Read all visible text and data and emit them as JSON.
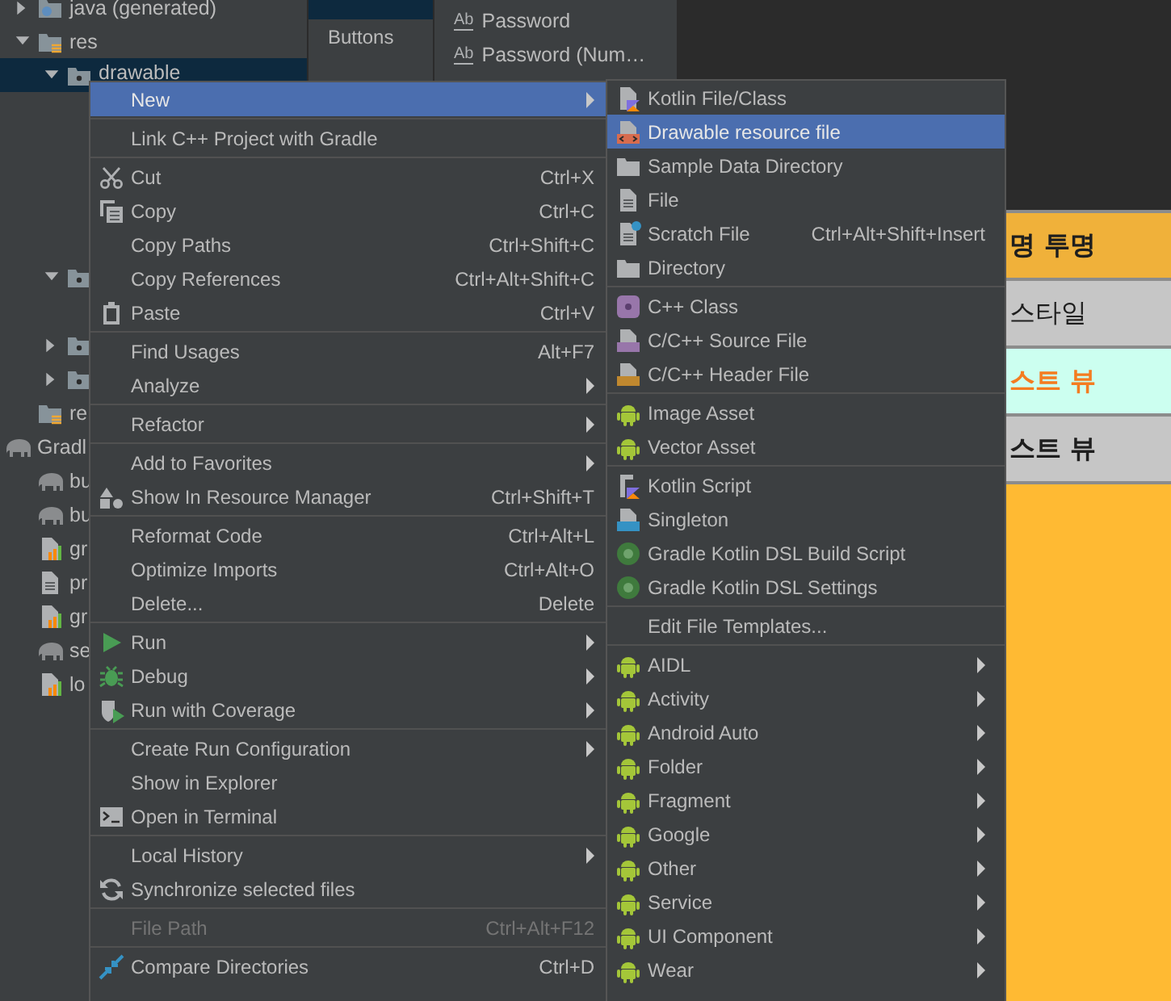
{
  "project_tree": [
    {
      "children": [
        {
          "label": "java (generated)",
          "kind": "java-folder",
          "expanded": false,
          "selected": false
        },
        {
          "label": "res",
          "kind": "res-folder",
          "expanded": true,
          "selected": false,
          "children": [
            {
              "label": "drawable",
              "kind": "folder",
              "expanded": true,
              "selected": true
            },
            {
              "kind": "folder",
              "expanded": true,
              "selected": false
            },
            {
              "kind": "folder",
              "expanded": false,
              "selected": false
            },
            {
              "kind": "folder",
              "expanded": false,
              "selected": false
            }
          ]
        },
        {
          "label": "re",
          "kind": "res-folder",
          "selected": false
        }
      ]
    },
    {
      "label": "Gradl",
      "kind": "gradle",
      "selected": false,
      "children": [
        {
          "label": "bu",
          "kind": "gradle",
          "selected": false
        },
        {
          "label": "bu",
          "kind": "gradle",
          "selected": false
        },
        {
          "label": "gr",
          "kind": "chart-file",
          "selected": false
        },
        {
          "label": "pr",
          "kind": "text-file",
          "selected": false
        },
        {
          "label": "gr",
          "kind": "chart-file",
          "selected": false
        },
        {
          "label": "se",
          "kind": "gradle",
          "selected": false
        },
        {
          "label": "lo",
          "kind": "chart-file",
          "selected": false
        }
      ]
    }
  ],
  "palette": {
    "categories": [
      {
        "selected": true
      },
      {
        "label": "Buttons",
        "selected": false
      }
    ],
    "items": [
      {
        "icon_text": "Ab",
        "label": "Password"
      },
      {
        "icon_text": "Ab",
        "label": "Password (Num…"
      }
    ]
  },
  "preview": {
    "buttons": [
      {
        "text": "명 투명",
        "color": "#f0b13a",
        "kind": "bold"
      },
      {
        "text": "스타일",
        "color": "#c6c6c6",
        "kind": "plain"
      },
      {
        "text": "스트 뷰",
        "color": "#ccfff0",
        "kind": "accent"
      },
      {
        "text": "스트 뷰",
        "color": "#c6c6c6",
        "kind": "bold"
      }
    ]
  },
  "context_menu": {
    "groups": [
      [
        {
          "label": "New",
          "submenu": true,
          "selected": true,
          "disabled": false
        }
      ],
      [
        {
          "label": "Link C++ Project with Gradle",
          "submenu": false,
          "selected": false,
          "disabled": false
        }
      ],
      [
        {
          "kind": "scissors",
          "label": "Cut",
          "shortcut": "Ctrl+X",
          "submenu": false,
          "selected": false,
          "disabled": false
        },
        {
          "kind": "copy",
          "label": "Copy",
          "shortcut": "Ctrl+C",
          "submenu": false,
          "selected": false,
          "disabled": false
        },
        {
          "label": "Copy Paths",
          "shortcut": "Ctrl+Shift+C",
          "submenu": false,
          "selected": false,
          "disabled": false
        },
        {
          "label": "Copy References",
          "shortcut": "Ctrl+Alt+Shift+C",
          "submenu": false,
          "selected": false,
          "disabled": false
        },
        {
          "kind": "paste",
          "label": "Paste",
          "shortcut": "Ctrl+V",
          "submenu": false,
          "selected": false,
          "disabled": false
        }
      ],
      [
        {
          "label": "Find Usages",
          "shortcut": "Alt+F7",
          "submenu": false,
          "selected": false,
          "disabled": false
        },
        {
          "label": "Analyze",
          "submenu": true,
          "selected": false,
          "disabled": false
        }
      ],
      [
        {
          "label": "Refactor",
          "submenu": true,
          "selected": false,
          "disabled": false
        }
      ],
      [
        {
          "label": "Add to Favorites",
          "submenu": true,
          "selected": false,
          "disabled": false
        },
        {
          "kind": "shapes",
          "label": "Show In Resource Manager",
          "shortcut": "Ctrl+Shift+T",
          "submenu": false,
          "selected": false,
          "disabled": false
        }
      ],
      [
        {
          "label": "Reformat Code",
          "shortcut": "Ctrl+Alt+L",
          "submenu": false,
          "selected": false,
          "disabled": false
        },
        {
          "label": "Optimize Imports",
          "shortcut": "Ctrl+Alt+O",
          "submenu": false,
          "selected": false,
          "disabled": false
        },
        {
          "label": "Delete...",
          "shortcut": "Delete",
          "submenu": false,
          "selected": false,
          "disabled": false
        }
      ],
      [
        {
          "kind": "run",
          "label": "Run",
          "submenu": true,
          "selected": false,
          "disabled": false
        },
        {
          "kind": "debug",
          "label": "Debug",
          "submenu": true,
          "selected": false,
          "disabled": false
        },
        {
          "kind": "coverage",
          "label": "Run with Coverage",
          "submenu": true,
          "selected": false,
          "disabled": false
        }
      ],
      [
        {
          "label": "Create Run Configuration",
          "submenu": true,
          "selected": false,
          "disabled": false
        },
        {
          "label": "Show in Explorer",
          "submenu": false,
          "selected": false,
          "disabled": false
        },
        {
          "kind": "terminal",
          "label": "Open in Terminal",
          "submenu": false,
          "selected": false,
          "disabled": false
        }
      ],
      [
        {
          "label": "Local History",
          "submenu": true,
          "selected": false,
          "disabled": false
        },
        {
          "kind": "sync",
          "label": "Synchronize selected files",
          "submenu": false,
          "selected": false,
          "disabled": false
        }
      ],
      [
        {
          "label": "File Path",
          "shortcut": "Ctrl+Alt+F12",
          "submenu": false,
          "selected": false,
          "disabled": true
        }
      ],
      [
        {
          "kind": "compare",
          "label": "Compare Directories",
          "shortcut": "Ctrl+D",
          "submenu": false,
          "selected": false,
          "disabled": false
        }
      ]
    ]
  },
  "new_submenu": {
    "groups": [
      [
        {
          "kind": "kotlin",
          "label": "Kotlin File/Class",
          "submenu": false,
          "selected": false,
          "disabled": false
        },
        {
          "kind": "drawable",
          "label": "Drawable resource file",
          "submenu": false,
          "selected": true,
          "disabled": false
        },
        {
          "kind": "folder",
          "label": "Sample Data Directory",
          "submenu": false,
          "selected": false,
          "disabled": false
        },
        {
          "kind": "file",
          "label": "File",
          "submenu": false,
          "selected": false,
          "disabled": false
        },
        {
          "kind": "scratch",
          "label": "Scratch File",
          "shortcut": "Ctrl+Alt+Shift+Insert",
          "submenu": false,
          "selected": false,
          "disabled": false
        },
        {
          "kind": "folder",
          "label": "Directory",
          "submenu": false,
          "selected": false,
          "disabled": false
        }
      ],
      [
        {
          "kind": "cpp-class",
          "label": "C++ Class",
          "submenu": false,
          "selected": false,
          "disabled": false
        },
        {
          "kind": "cpp-source",
          "label": "C/C++ Source File",
          "submenu": false,
          "selected": false,
          "disabled": false
        },
        {
          "kind": "cpp-header",
          "label": "C/C++ Header File",
          "submenu": false,
          "selected": false,
          "disabled": false
        }
      ],
      [
        {
          "kind": "android",
          "label": "Image Asset",
          "submenu": false,
          "selected": false,
          "disabled": false
        },
        {
          "kind": "android",
          "label": "Vector Asset",
          "submenu": false,
          "selected": false,
          "disabled": false
        }
      ],
      [
        {
          "kind": "kotlin-script",
          "label": "Kotlin Script",
          "submenu": false,
          "selected": false,
          "disabled": false
        },
        {
          "kind": "singleton",
          "label": "Singleton",
          "submenu": false,
          "selected": false,
          "disabled": false
        },
        {
          "kind": "gradle",
          "label": "Gradle Kotlin DSL Build Script",
          "submenu": false,
          "selected": false,
          "disabled": false
        },
        {
          "kind": "gradle",
          "label": "Gradle Kotlin DSL Settings",
          "submenu": false,
          "selected": false,
          "disabled": false
        }
      ],
      [
        {
          "label": "Edit File Templates...",
          "submenu": false,
          "selected": false,
          "disabled": false
        }
      ],
      [
        {
          "kind": "android",
          "label": "AIDL",
          "submenu": true,
          "selected": false,
          "disabled": false
        },
        {
          "kind": "android",
          "label": "Activity",
          "submenu": true,
          "selected": false,
          "disabled": false
        },
        {
          "kind": "android",
          "label": "Android Auto",
          "submenu": true,
          "selected": false,
          "disabled": false
        },
        {
          "kind": "android",
          "label": "Folder",
          "submenu": true,
          "selected": false,
          "disabled": false
        },
        {
          "kind": "android",
          "label": "Fragment",
          "submenu": true,
          "selected": false,
          "disabled": false
        },
        {
          "kind": "android",
          "label": "Google",
          "submenu": true,
          "selected": false,
          "disabled": false
        },
        {
          "kind": "android",
          "label": "Other",
          "submenu": true,
          "selected": false,
          "disabled": false
        },
        {
          "kind": "android",
          "label": "Service",
          "submenu": true,
          "selected": false,
          "disabled": false
        },
        {
          "kind": "android",
          "label": "UI Component",
          "submenu": true,
          "selected": false,
          "disabled": false
        },
        {
          "kind": "android",
          "label": "Wear",
          "submenu": true,
          "selected": false,
          "disabled": false
        }
      ]
    ]
  }
}
